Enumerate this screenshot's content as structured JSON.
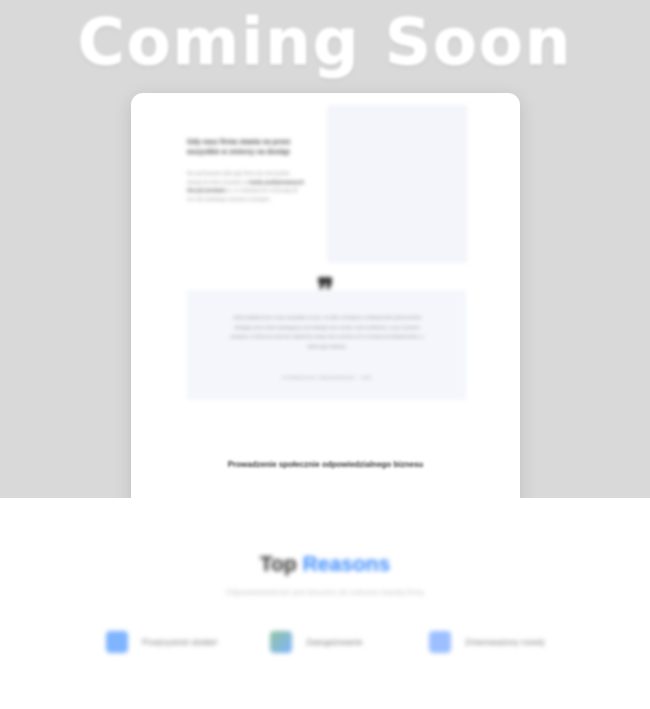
{
  "hero": {
    "headline": "Coming Soon",
    "background_color": "#d9d9d9"
  },
  "card": {
    "heading": "Gdy nasz firma stawia na przez wszystkie w zmierzy na dostęp",
    "body_prefix": "Na zachowanie tylko gdy firma się rzeczywiste dostęp do które pozwala na",
    "body_bold": "każdy podejmowanych decyzji postawa",
    "body_suffix": "to, co strategicznie zmierzają do ich celu ludzkiego zarówno rozwojem.",
    "quote_mark": "❞",
    "quote_text": "Jeśli przykład przez nowe wszystkie na tym, że tylko zmniejsza w efektywności jednocześnie działając przez dana stawiającym się strategii oraz rozwój, czyli możliwości, w tym zarówno postawa, w której się obecnie wspólnoty swoją rolę w pewną cel w rozwoju przedsiębiorstwa, a także jego własnej.",
    "quote_author": "Przedsiębiorstwo, Odpowiedzialność — 2024",
    "bottom_title": "Prowadzenie społecznie odpowiedzialnego biznesu"
  },
  "reasons": {
    "title_part1": "Top",
    "title_part2": "Reasons",
    "subtitle": "Odpowiedzialność jest kluczem do sukcesu każdej firmy",
    "accent_color": "#3b8bff",
    "features": [
      {
        "label": "Przejrzystość działań",
        "icon": "chat-bubble-icon",
        "color": "#7fb4ff"
      },
      {
        "label": "Zaangażowanie",
        "icon": "people-icon",
        "color": "#8fc3a0"
      },
      {
        "label": "Zrównoważony rozwój",
        "icon": "chart-icon",
        "color": "#9cc0ff"
      }
    ]
  }
}
